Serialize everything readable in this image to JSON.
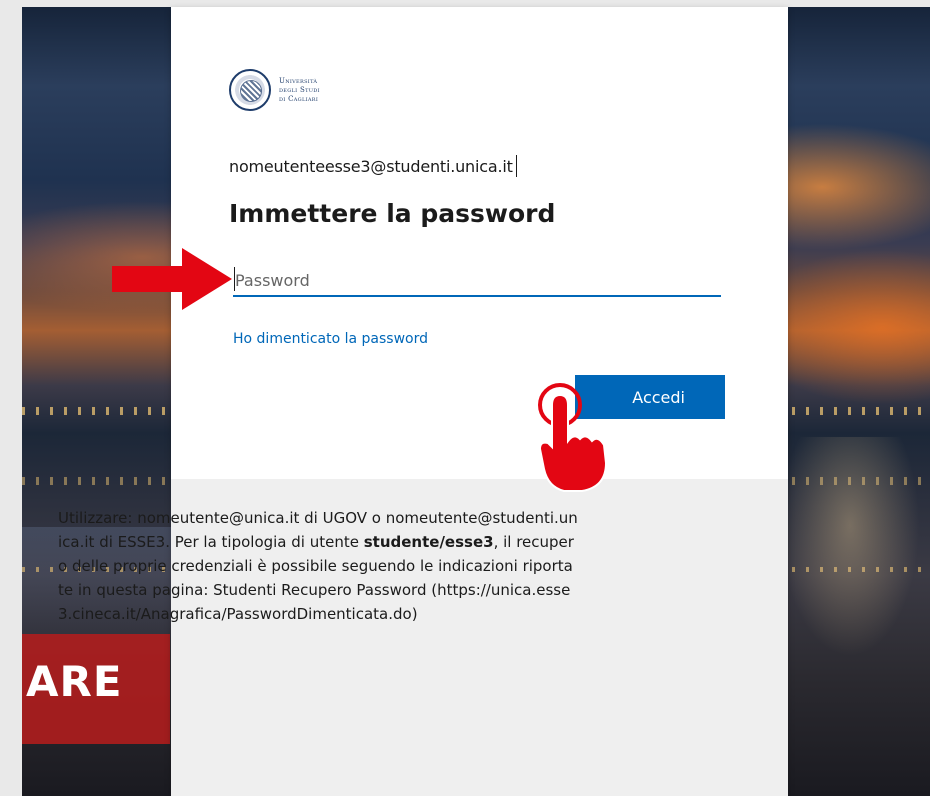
{
  "university": {
    "name_line1": "Università",
    "name_line2": "degli Studi",
    "name_line3": "di Cagliari"
  },
  "login": {
    "identity": "nomeutenteesse3@studenti.unica.it",
    "title": "Immettere la password",
    "password_placeholder": "Password",
    "forgot_link": "Ho dimenticato la password",
    "submit_label": "Accedi"
  },
  "info": {
    "text_before": "Utilizzare: nomeutente@unica.it di UGOV o nomeutente@studenti.unica.it di ESSE3. Per la tipologia di utente ",
    "bold_text": "studente/esse3",
    "text_after": ", il recupero delle proprie credenziali è possibile seguendo le indicazioni riportate in questa pagina: Studenti Recupero Password (https://unica.esse3.cineca.it/Anagrafica/PasswordDimenticata.do)"
  },
  "background": {
    "banner_text": "ARE"
  },
  "colors": {
    "accent": "#0067b8",
    "annotation_red": "#e30613"
  },
  "annotations": {
    "arrow_icon": "right-arrow-icon",
    "hand_icon": "pointing-hand-icon"
  }
}
